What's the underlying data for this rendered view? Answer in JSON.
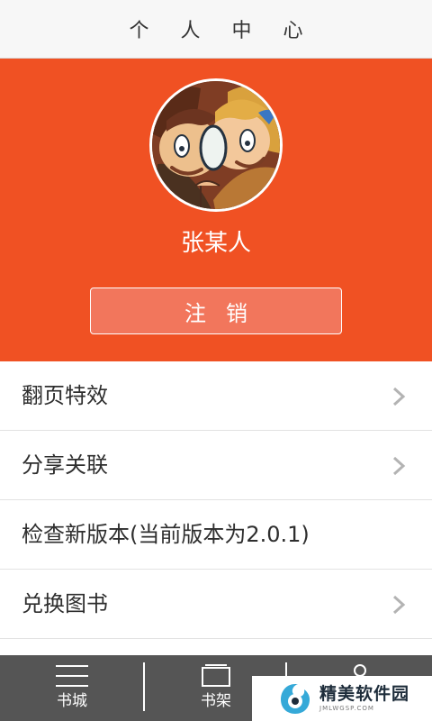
{
  "header": {
    "title": "个 人 中 心"
  },
  "profile": {
    "username": "张某人",
    "logout_label": "注销"
  },
  "menu": {
    "items": [
      {
        "label": "翻页特效",
        "has_arrow": true
      },
      {
        "label": "分享关联",
        "has_arrow": true
      },
      {
        "label": "检查新版本(当前版本为2.0.1)",
        "has_arrow": false
      },
      {
        "label": "兑换图书",
        "has_arrow": true
      }
    ]
  },
  "bottom_nav": {
    "items": [
      {
        "label": "书城",
        "icon": "menu-icon"
      },
      {
        "label": "书架",
        "icon": "bookshelf-icon"
      },
      {
        "label": "",
        "icon": "user-icon"
      }
    ]
  },
  "watermark": {
    "text": "精美软件园",
    "sub": "JMLWGSP.COM"
  },
  "colors": {
    "header_bg": "#f7f7f7",
    "profile_bg": "#f05123",
    "logout_bg": "#f2765c",
    "nav_bg": "#555555",
    "arrow": "#b3b3b3"
  }
}
